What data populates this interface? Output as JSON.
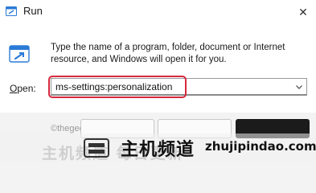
{
  "window": {
    "title": "Run",
    "close_glyph": "✕",
    "icon": "run-app-icon"
  },
  "dialog": {
    "description": "Type the name of a program, folder, document or Internet resource, and Windows will open it for you.",
    "open_label_mnemonic": "O",
    "open_label_rest": "pen:",
    "open_value": "ms-settings:personalization",
    "icon": "run-large-icon"
  },
  "footer": {
    "watermark": "©thegeekpage.com"
  },
  "overlay": {
    "brand_cn": "主机频道",
    "brand_domain": "zhujipindao.com",
    "ghost_cn": "主机频道 每日更新"
  },
  "colors": {
    "highlight": "#d6293d",
    "icon_blue": "#2b7bd6"
  }
}
